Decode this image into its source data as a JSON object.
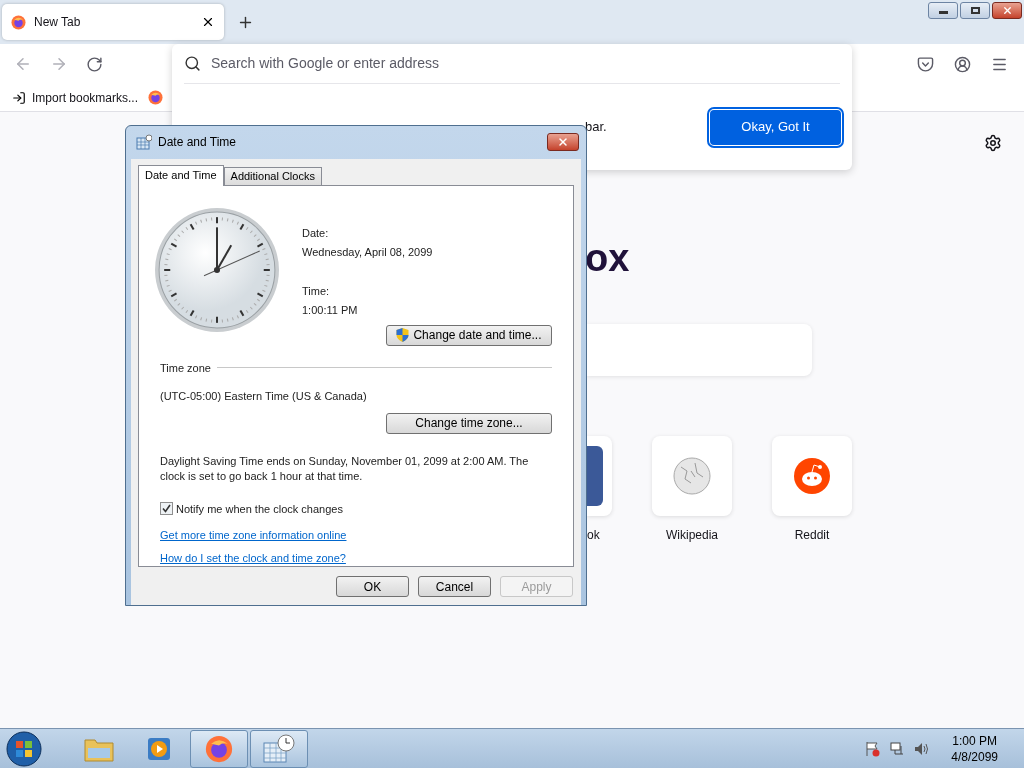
{
  "browser": {
    "tabs": [
      {
        "title": "New Tab",
        "selected": true
      }
    ],
    "address_bar": {
      "placeholder": "Search with Google or enter address"
    },
    "bookmarks": [
      {
        "label": "Import bookmarks..."
      }
    ],
    "notice": {
      "text_tail": "bar.",
      "button": "Okay, Got It"
    },
    "new_tab": {
      "logo_text_tail": "ox",
      "shortcuts": [
        {
          "label": "ok",
          "kind": "facebook"
        },
        {
          "label": "Wikipedia",
          "kind": "wikipedia"
        },
        {
          "label": "Reddit",
          "kind": "reddit"
        }
      ]
    }
  },
  "dialog": {
    "title": "Date and Time",
    "tabs": [
      {
        "label": "Date and Time",
        "selected": true
      },
      {
        "label": "Additional Clocks",
        "selected": false
      }
    ],
    "date_label": "Date:",
    "date": "Wednesday, April 08, 2099",
    "time_label": "Time:",
    "time": "1:00:11 PM",
    "change_datetime_button": "Change date and time...",
    "timezone_heading": "Time zone",
    "timezone": "(UTC-05:00) Eastern Time (US & Canada)",
    "change_timezone_button": "Change time zone...",
    "dst_note": "Daylight Saving Time ends on Sunday, November 01, 2099 at 2:00 AM. The clock is set to go back 1 hour at that time.",
    "notify": {
      "label": "Notify me when the clock changes",
      "checked": true
    },
    "links": [
      "Get more time zone information online",
      "How do I set the clock and time zone?"
    ],
    "buttons": [
      {
        "label": "OK",
        "disabled": false
      },
      {
        "label": "Cancel",
        "disabled": false
      },
      {
        "label": "Apply",
        "disabled": true
      }
    ]
  },
  "taskbar": {
    "apps": [
      {
        "kind": "explorer",
        "active": false
      },
      {
        "kind": "media",
        "active": false
      },
      {
        "kind": "firefox",
        "active": true
      },
      {
        "kind": "clock",
        "active": true
      }
    ],
    "clock": {
      "time": "1:00 PM",
      "date": "4/8/2099"
    }
  }
}
